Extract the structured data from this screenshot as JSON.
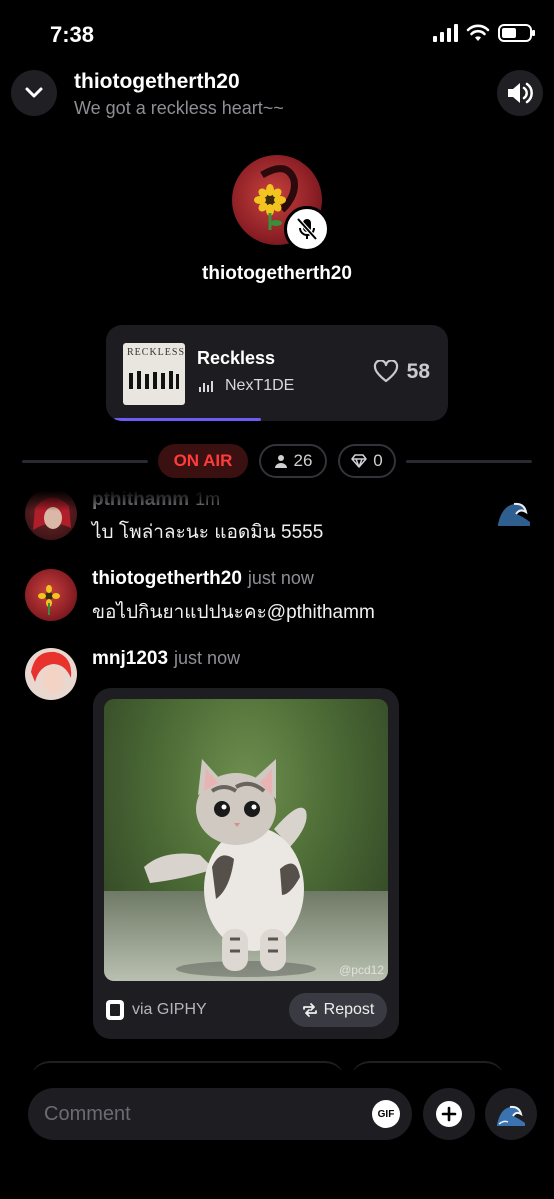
{
  "status_bar": {
    "time": "7:38",
    "signal_icon": "cellular-signal-icon",
    "wifi_icon": "wifi-icon",
    "battery_icon": "battery-icon"
  },
  "header": {
    "collapse_icon": "chevron-down-icon",
    "title": "thiotogetherth20",
    "subtitle": "We got a reckless heart~~",
    "sound_icon": "speaker-icon"
  },
  "host": {
    "name": "thiotogetherth20",
    "mic_state_icon": "mic-off-icon"
  },
  "now_playing": {
    "title": "Reckless",
    "artist": "NexT1DE",
    "album_text": "RECKLESS",
    "likes": "58",
    "progress": 0.43
  },
  "room_status": {
    "on_air": "ON AIR",
    "listeners": "26",
    "gems": "0"
  },
  "chat": {
    "messages": [
      {
        "user": "pthithamm",
        "time": "1m",
        "text": "ไบ โพล่าละนะ แอดมิน 5555"
      },
      {
        "user": "thiotogetherth20",
        "time": "just now",
        "text": "ขอไปกินยาแปปนะคะ@pthithamm"
      },
      {
        "user": "mnj1203",
        "time": "just now",
        "gif": {
          "source": "via GIPHY",
          "watermark": "@pcd12",
          "repost_label": "Repost"
        }
      }
    ]
  },
  "composer": {
    "placeholder": "Comment",
    "gif_label": "GIF",
    "add_icon": "plus-icon",
    "wave_icon": "wave-icon"
  },
  "colors": {
    "accent": "#6a5cf5",
    "on_air": "#ff3b3b",
    "on_air_bg": "#3a1010",
    "surface": "#1c1c21"
  }
}
